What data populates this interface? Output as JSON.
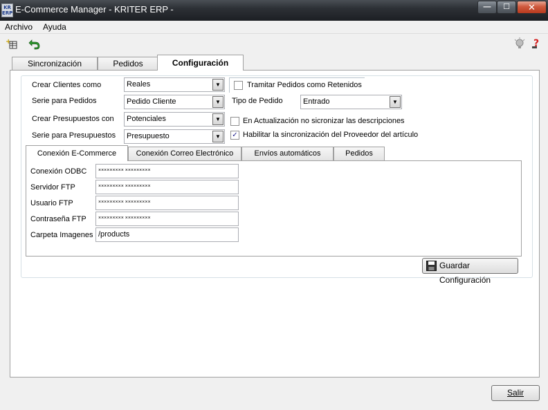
{
  "window": {
    "app_icon_text": "KR ERP",
    "title": "E-Commerce Manager - KRITER ERP -",
    "min_glyph": "—",
    "max_glyph": "☐",
    "close_glyph": "✕"
  },
  "menu": {
    "archivo": "Archivo",
    "ayuda": "Ayuda"
  },
  "toolbar": {
    "icons": [
      "new-grid-icon",
      "undo-arrow-icon",
      "lightbulb-icon",
      "help-icon"
    ]
  },
  "tabs": [
    {
      "label": "Sincronización"
    },
    {
      "label": "Pedidos"
    },
    {
      "label": "Configuración"
    }
  ],
  "config": {
    "crear_clientes_label": "Crear Clientes como",
    "crear_clientes_value": "Reales",
    "serie_pedidos_label": "Serie para Pedidos",
    "serie_pedidos_value": "Pedido Cliente",
    "crear_presupuestos_label": "Crear Presupuestos con",
    "crear_presupuestos_value": "Potenciales",
    "serie_presupuestos_label": "Serie para Presupuestos",
    "serie_presupuestos_value": "Presupuesto",
    "tramitar_label": "Tramitar Pedidos como Retenidos",
    "tramitar_checked": false,
    "tipo_pedido_label": "Tipo de Pedido",
    "tipo_pedido_value": "Entrado",
    "no_sincronizar_label": "En Actualización no sicronizar las descripciones",
    "no_sincronizar_checked": false,
    "habilitar_proveedor_label": "Habilitar la sincronización del Proveedor del artículo",
    "habilitar_proveedor_checked": true,
    "check_glyph": "✓",
    "arrow_glyph": "▼"
  },
  "subtabs": [
    {
      "label": "Conexión E-Commerce"
    },
    {
      "label": "Conexión Correo Electrónico"
    },
    {
      "label": "Envíos automáticos"
    },
    {
      "label": "Pedidos"
    }
  ],
  "conexion": {
    "odbc_label": "Conexión ODBC",
    "odbc_value": "××××××××× ×××××××××",
    "ftp_server_label": "Servidor FTP",
    "ftp_server_value": "××××××××× ×××××××××",
    "ftp_user_label": "Usuario FTP",
    "ftp_user_value": "××××××××× ×××××××××",
    "ftp_pass_label": "Contraseña FTP",
    "ftp_pass_value": "××××××××× ×××××××××",
    "images_label": "Carpeta Imagenes",
    "images_value": "/products"
  },
  "buttons": {
    "guardar": "Guardar Configuración",
    "salir": "Salir"
  }
}
